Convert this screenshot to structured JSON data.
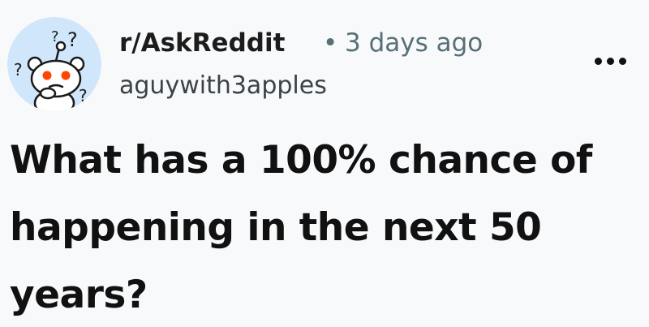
{
  "post": {
    "subreddit": "r/AskReddit",
    "separator": "•",
    "timestamp": "3 days ago",
    "username": "aguywith3apples",
    "title": "What has a 100% chance of happening in the next 50 years?"
  },
  "icons": {
    "avatar": "reddit-snoo-confused-icon",
    "more": "more-options-icon"
  },
  "colors": {
    "background": "#f8f9fb",
    "avatar_bg": "#cfe6fb",
    "snoo_eye": "#ff4500",
    "meta_text": "#576f76"
  }
}
